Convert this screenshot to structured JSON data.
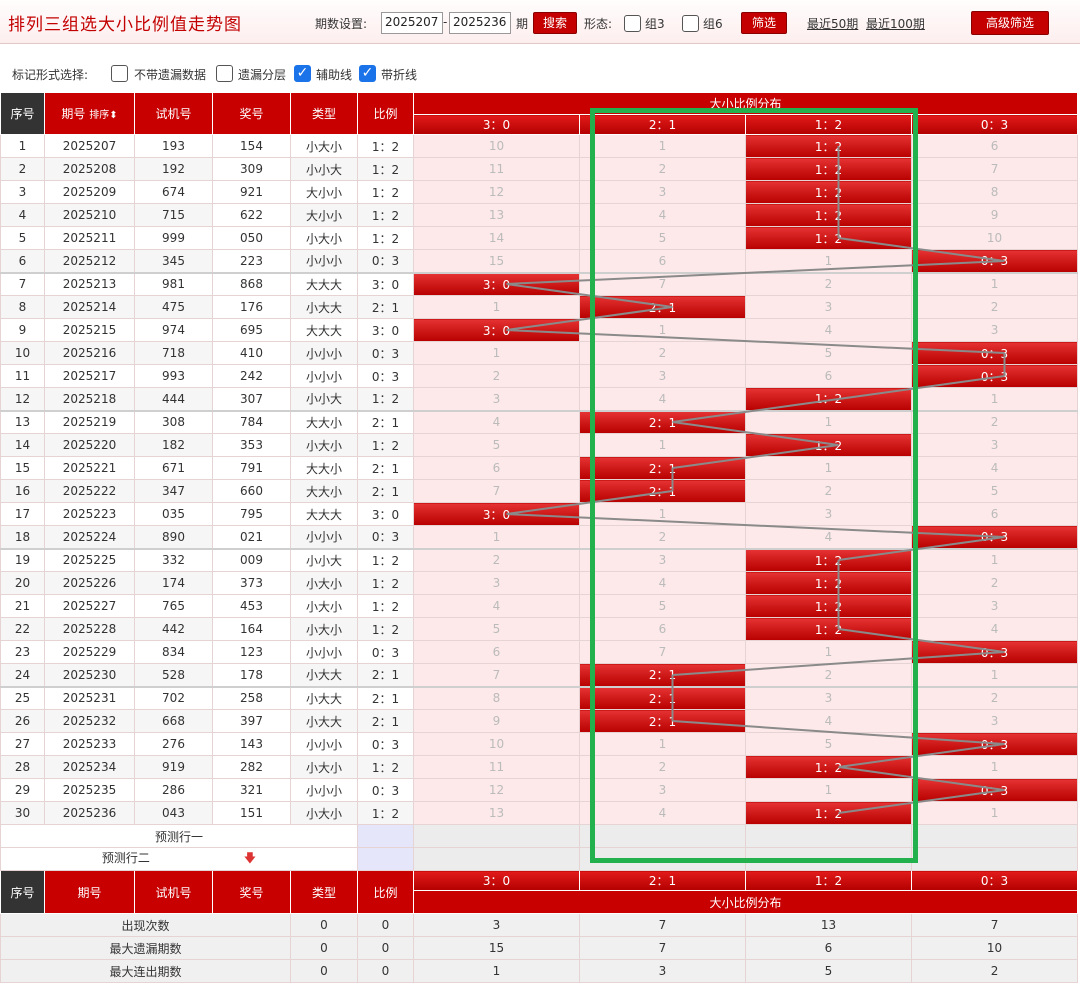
{
  "header": {
    "title": "排列三组选大小比例值走势图",
    "period_label": "期数设置:",
    "period_from": "2025207",
    "period_dash": "-",
    "period_to": "2025236",
    "period_unit": "期",
    "search_btn": "搜索",
    "shape_label": "形态:",
    "group3_label": "组3",
    "group6_label": "组6",
    "filter_btn": "筛选",
    "recent50": "最近50期",
    "recent100": "最近100期",
    "advanced_btn": "高级筛选"
  },
  "options": {
    "label": "标记形式选择:",
    "items": [
      {
        "label": "不带遗漏数据",
        "checked": false
      },
      {
        "label": "遗漏分层",
        "checked": false
      },
      {
        "label": "辅助线",
        "checked": true
      },
      {
        "label": "带折线",
        "checked": true
      }
    ]
  },
  "columns": {
    "seq": "序号",
    "issue": "期号",
    "sort": "排序",
    "trial": "试机号",
    "prize": "奖号",
    "type": "类型",
    "ratio": "比例",
    "dist_title": "大小比例分布",
    "dist_cols": [
      "3：0",
      "2：1",
      "1：2",
      "0：3"
    ]
  },
  "colors": {
    "hit_red": "#c80000",
    "miss_bg": "#fde9e9",
    "highlight_green": "#22b14c",
    "line_gray": "#8a8a8a"
  },
  "chart_data": {
    "type": "table",
    "title": "排列三组选大小比例值走势图",
    "categories": [
      "3：0",
      "2：1",
      "1：2",
      "0：3"
    ],
    "rows": [
      {
        "seq": "1",
        "issue": "2025207",
        "trial": "193",
        "prize": "154",
        "type": "小大小",
        "ratio": "1：2",
        "hit": 2,
        "miss": [
          "10",
          "1",
          "",
          "6"
        ]
      },
      {
        "seq": "2",
        "issue": "2025208",
        "trial": "192",
        "prize": "309",
        "type": "小小大",
        "ratio": "1：2",
        "hit": 2,
        "miss": [
          "11",
          "2",
          "",
          "7"
        ]
      },
      {
        "seq": "3",
        "issue": "2025209",
        "trial": "674",
        "prize": "921",
        "type": "大小小",
        "ratio": "1：2",
        "hit": 2,
        "miss": [
          "12",
          "3",
          "",
          "8"
        ]
      },
      {
        "seq": "4",
        "issue": "2025210",
        "trial": "715",
        "prize": "622",
        "type": "大小小",
        "ratio": "1：2",
        "hit": 2,
        "miss": [
          "13",
          "4",
          "",
          "9"
        ]
      },
      {
        "seq": "5",
        "issue": "2025211",
        "trial": "999",
        "prize": "050",
        "type": "小大小",
        "ratio": "1：2",
        "hit": 2,
        "miss": [
          "14",
          "5",
          "",
          "10"
        ]
      },
      {
        "seq": "6",
        "issue": "2025212",
        "trial": "345",
        "prize": "223",
        "type": "小小小",
        "ratio": "0：3",
        "hit": 3,
        "miss": [
          "15",
          "6",
          "1",
          ""
        ]
      },
      {
        "seq": "7",
        "issue": "2025213",
        "trial": "981",
        "prize": "868",
        "type": "大大大",
        "ratio": "3：0",
        "hit": 0,
        "miss": [
          "",
          "7",
          "2",
          "1"
        ]
      },
      {
        "seq": "8",
        "issue": "2025214",
        "trial": "475",
        "prize": "176",
        "type": "小大大",
        "ratio": "2：1",
        "hit": 1,
        "miss": [
          "1",
          "",
          "3",
          "2"
        ]
      },
      {
        "seq": "9",
        "issue": "2025215",
        "trial": "974",
        "prize": "695",
        "type": "大大大",
        "ratio": "3：0",
        "hit": 0,
        "miss": [
          "",
          "1",
          "4",
          "3"
        ]
      },
      {
        "seq": "10",
        "issue": "2025216",
        "trial": "718",
        "prize": "410",
        "type": "小小小",
        "ratio": "0：3",
        "hit": 3,
        "miss": [
          "1",
          "2",
          "5",
          ""
        ]
      },
      {
        "seq": "11",
        "issue": "2025217",
        "trial": "993",
        "prize": "242",
        "type": "小小小",
        "ratio": "0：3",
        "hit": 3,
        "miss": [
          "2",
          "3",
          "6",
          ""
        ]
      },
      {
        "seq": "12",
        "issue": "2025218",
        "trial": "444",
        "prize": "307",
        "type": "小小大",
        "ratio": "1：2",
        "hit": 2,
        "miss": [
          "3",
          "4",
          "",
          "1"
        ]
      },
      {
        "seq": "13",
        "issue": "2025219",
        "trial": "308",
        "prize": "784",
        "type": "大大小",
        "ratio": "2：1",
        "hit": 1,
        "miss": [
          "4",
          "",
          "1",
          "2"
        ]
      },
      {
        "seq": "14",
        "issue": "2025220",
        "trial": "182",
        "prize": "353",
        "type": "小大小",
        "ratio": "1：2",
        "hit": 2,
        "miss": [
          "5",
          "1",
          "",
          "3"
        ]
      },
      {
        "seq": "15",
        "issue": "2025221",
        "trial": "671",
        "prize": "791",
        "type": "大大小",
        "ratio": "2：1",
        "hit": 1,
        "miss": [
          "6",
          "",
          "1",
          "4"
        ]
      },
      {
        "seq": "16",
        "issue": "2025222",
        "trial": "347",
        "prize": "660",
        "type": "大大小",
        "ratio": "2：1",
        "hit": 1,
        "miss": [
          "7",
          "",
          "2",
          "5"
        ]
      },
      {
        "seq": "17",
        "issue": "2025223",
        "trial": "035",
        "prize": "795",
        "type": "大大大",
        "ratio": "3：0",
        "hit": 0,
        "miss": [
          "",
          "1",
          "3",
          "6"
        ]
      },
      {
        "seq": "18",
        "issue": "2025224",
        "trial": "890",
        "prize": "021",
        "type": "小小小",
        "ratio": "0：3",
        "hit": 3,
        "miss": [
          "1",
          "2",
          "4",
          ""
        ]
      },
      {
        "seq": "19",
        "issue": "2025225",
        "trial": "332",
        "prize": "009",
        "type": "小小大",
        "ratio": "1：2",
        "hit": 2,
        "miss": [
          "2",
          "3",
          "",
          "1"
        ]
      },
      {
        "seq": "20",
        "issue": "2025226",
        "trial": "174",
        "prize": "373",
        "type": "小大小",
        "ratio": "1：2",
        "hit": 2,
        "miss": [
          "3",
          "4",
          "",
          "2"
        ]
      },
      {
        "seq": "21",
        "issue": "2025227",
        "trial": "765",
        "prize": "453",
        "type": "小大小",
        "ratio": "1：2",
        "hit": 2,
        "miss": [
          "4",
          "5",
          "",
          "3"
        ]
      },
      {
        "seq": "22",
        "issue": "2025228",
        "trial": "442",
        "prize": "164",
        "type": "小大小",
        "ratio": "1：2",
        "hit": 2,
        "miss": [
          "5",
          "6",
          "",
          "4"
        ]
      },
      {
        "seq": "23",
        "issue": "2025229",
        "trial": "834",
        "prize": "123",
        "type": "小小小",
        "ratio": "0：3",
        "hit": 3,
        "miss": [
          "6",
          "7",
          "1",
          ""
        ]
      },
      {
        "seq": "24",
        "issue": "2025230",
        "trial": "528",
        "prize": "178",
        "type": "小大大",
        "ratio": "2：1",
        "hit": 1,
        "miss": [
          "7",
          "",
          "2",
          "1"
        ]
      },
      {
        "seq": "25",
        "issue": "2025231",
        "trial": "702",
        "prize": "258",
        "type": "小大大",
        "ratio": "2：1",
        "hit": 1,
        "miss": [
          "8",
          "",
          "3",
          "2"
        ]
      },
      {
        "seq": "26",
        "issue": "2025232",
        "trial": "668",
        "prize": "397",
        "type": "小大大",
        "ratio": "2：1",
        "hit": 1,
        "miss": [
          "9",
          "",
          "4",
          "3"
        ]
      },
      {
        "seq": "27",
        "issue": "2025233",
        "trial": "276",
        "prize": "143",
        "type": "小小小",
        "ratio": "0：3",
        "hit": 3,
        "miss": [
          "10",
          "1",
          "5",
          ""
        ]
      },
      {
        "seq": "28",
        "issue": "2025234",
        "trial": "919",
        "prize": "282",
        "type": "小大小",
        "ratio": "1：2",
        "hit": 2,
        "miss": [
          "11",
          "2",
          "",
          "1"
        ]
      },
      {
        "seq": "29",
        "issue": "2025235",
        "trial": "286",
        "prize": "321",
        "type": "小小小",
        "ratio": "0：3",
        "hit": 3,
        "miss": [
          "12",
          "3",
          "1",
          ""
        ]
      },
      {
        "seq": "30",
        "issue": "2025236",
        "trial": "043",
        "prize": "151",
        "type": "小大小",
        "ratio": "1：2",
        "hit": 2,
        "miss": [
          "13",
          "4",
          "",
          "1"
        ]
      }
    ],
    "predict_rows": [
      "预测行一",
      "预测行二"
    ],
    "stats": [
      {
        "label": "出现次数",
        "type": "0",
        "ratio": "0",
        "values": [
          "3",
          "7",
          "13",
          "7"
        ]
      },
      {
        "label": "最大遗漏期数",
        "type": "0",
        "ratio": "0",
        "values": [
          "15",
          "7",
          "6",
          "10"
        ]
      },
      {
        "label": "最大连出期数",
        "type": "0",
        "ratio": "0",
        "values": [
          "1",
          "3",
          "5",
          "2"
        ]
      }
    ]
  }
}
